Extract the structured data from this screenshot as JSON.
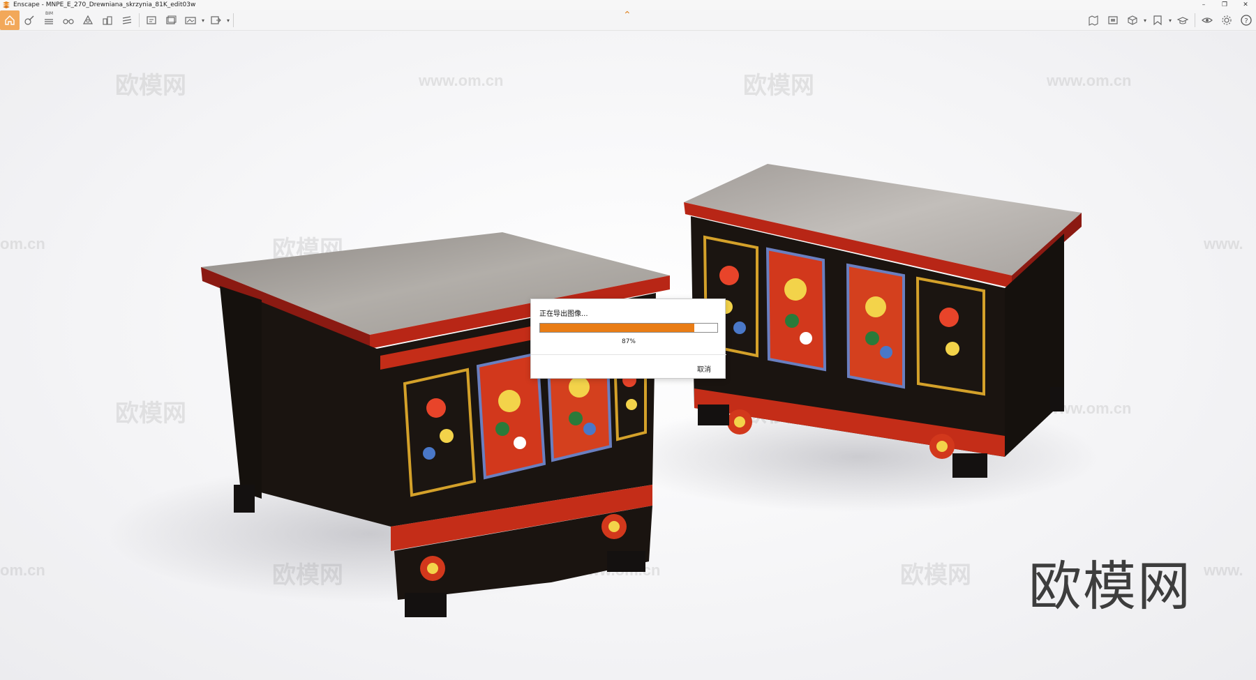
{
  "window": {
    "title": "Enscape - MNPE_E_270_Drewniana_skrzynia_81K_edit03w",
    "controls": [
      "–",
      "❐",
      "✕"
    ]
  },
  "toolbar": {
    "left_icons": [
      "home-icon",
      "paint-icon",
      "list-icon",
      "binoculars-icon",
      "asset-icon",
      "buildings-icon",
      "layers-icon",
      "screenshot-icon",
      "batch-render-icon",
      "panorama-icon",
      "export-icon"
    ],
    "bim_label": "BIM",
    "right_icons": [
      "map-icon",
      "frame-icon",
      "cube-icon",
      "bookmark-icon",
      "cap-icon",
      "eye-icon",
      "gear-icon",
      "help-icon"
    ],
    "accent_color": "#f2a85a"
  },
  "watermarks": {
    "brand": "欧模网",
    "site": "www.om.cn",
    "site_short": "om.cn",
    "site_left_cut": "www."
  },
  "dialog": {
    "title": "正在导出图像...",
    "progress_percent": 87,
    "progress_label": "87%",
    "cancel_label": "取消",
    "fill_color": "#e97d16"
  }
}
